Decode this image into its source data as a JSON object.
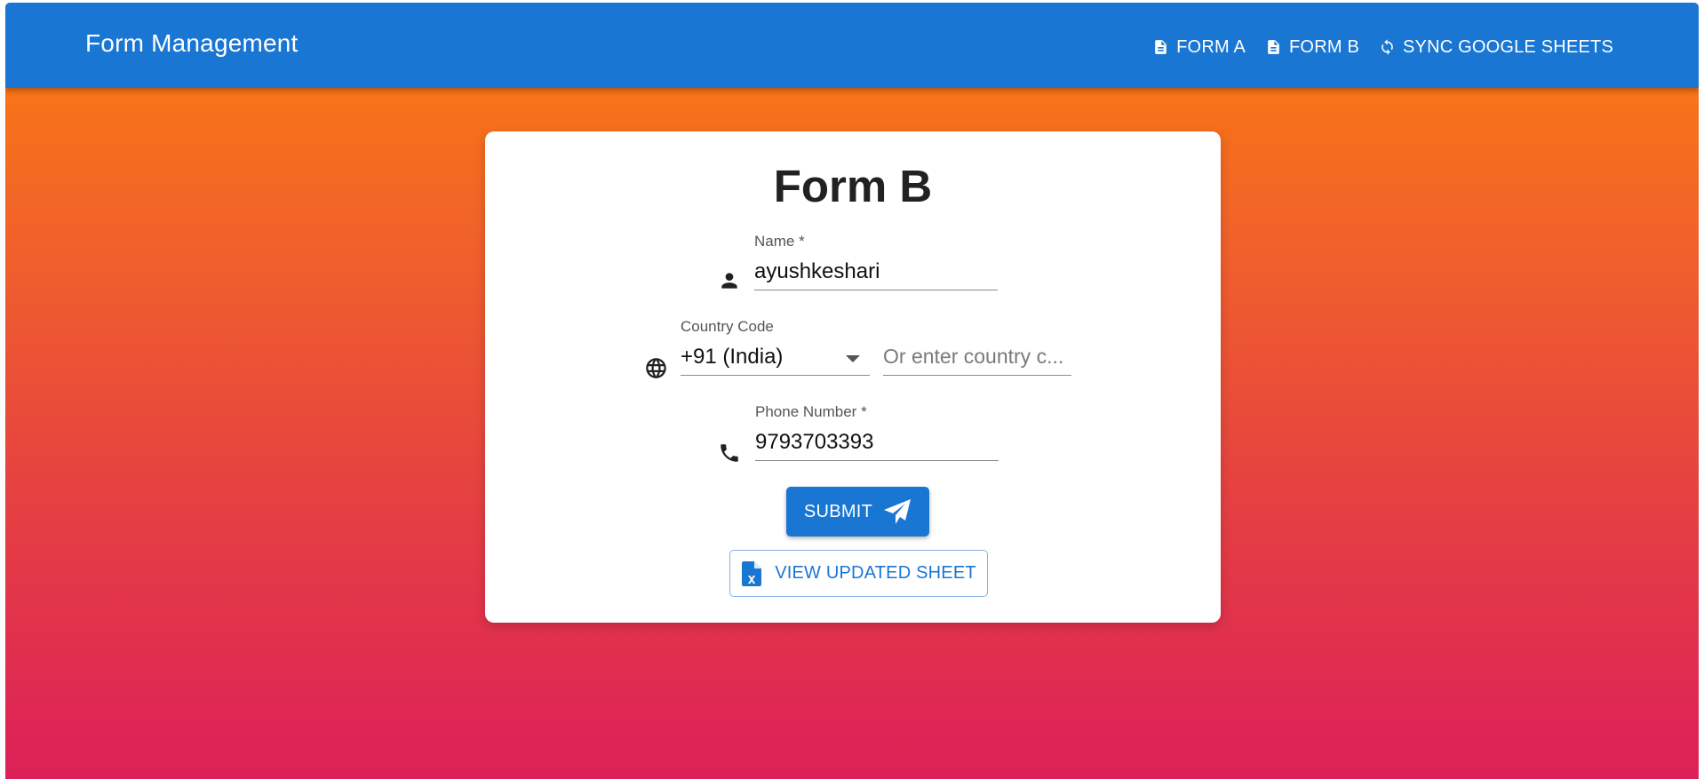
{
  "appbar": {
    "title": "Form Management",
    "nav": [
      {
        "label": "FORM A",
        "icon": "document-icon"
      },
      {
        "label": "FORM B",
        "icon": "document-icon"
      },
      {
        "label": "SYNC GOOGLE SHEETS",
        "icon": "sync-icon"
      }
    ]
  },
  "form": {
    "title": "Form B",
    "name": {
      "label": "Name *",
      "value": "ayushkeshari",
      "icon": "person-icon"
    },
    "country_code": {
      "label": "Country Code",
      "selected": "+91 (India)",
      "icon": "globe-icon"
    },
    "custom_country_code": {
      "placeholder": "Or enter country c..."
    },
    "phone": {
      "label": "Phone Number *",
      "value": "9793703393",
      "icon": "phone-icon"
    },
    "submit_label": "SUBMIT",
    "view_sheet_label": "VIEW UPDATED SHEET"
  },
  "colors": {
    "appbar": "#1976d2",
    "gradient_top": "#fb7d0c",
    "gradient_bottom": "#dc2058",
    "button": "#1976d2"
  }
}
